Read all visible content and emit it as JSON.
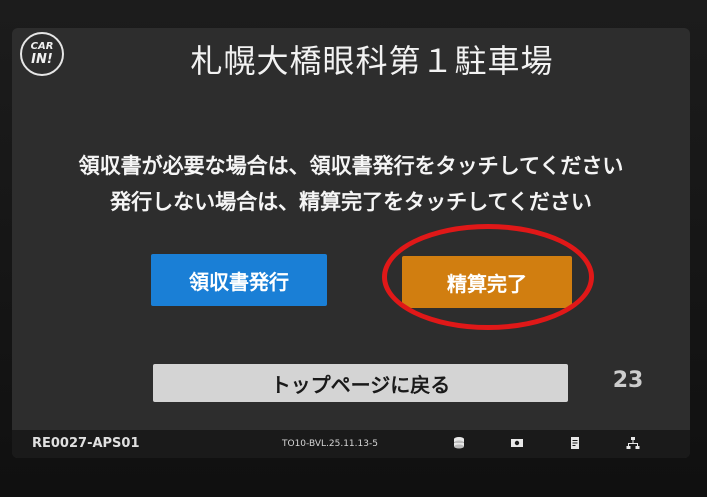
{
  "header": {
    "logo_line1": "CAR",
    "logo_line2": "IN!",
    "title": "札幌大橋眼科第１駐車場"
  },
  "message": {
    "line1": "領収書が必要な場合は、領収書発行をタッチしてください",
    "line2": "発行しない場合は、精算完了をタッチしてください"
  },
  "buttons": {
    "receipt_label": "領収書発行",
    "complete_label": "精算完了",
    "top_page_label": "トップページに戻る"
  },
  "countdown": "23",
  "footer": {
    "station_id": "RE0027-APS01",
    "version": "TO10-BVL.25.11.13-5",
    "icons": [
      "coin-icon",
      "bill-icon",
      "receipt-icon",
      "network-icon"
    ]
  },
  "colors": {
    "receipt_button": "#1a7fd6",
    "complete_button": "#d17e10",
    "top_button": "#d4d4d4",
    "highlight_ring": "#e01818",
    "screen_bg": "#2d2d2d"
  }
}
